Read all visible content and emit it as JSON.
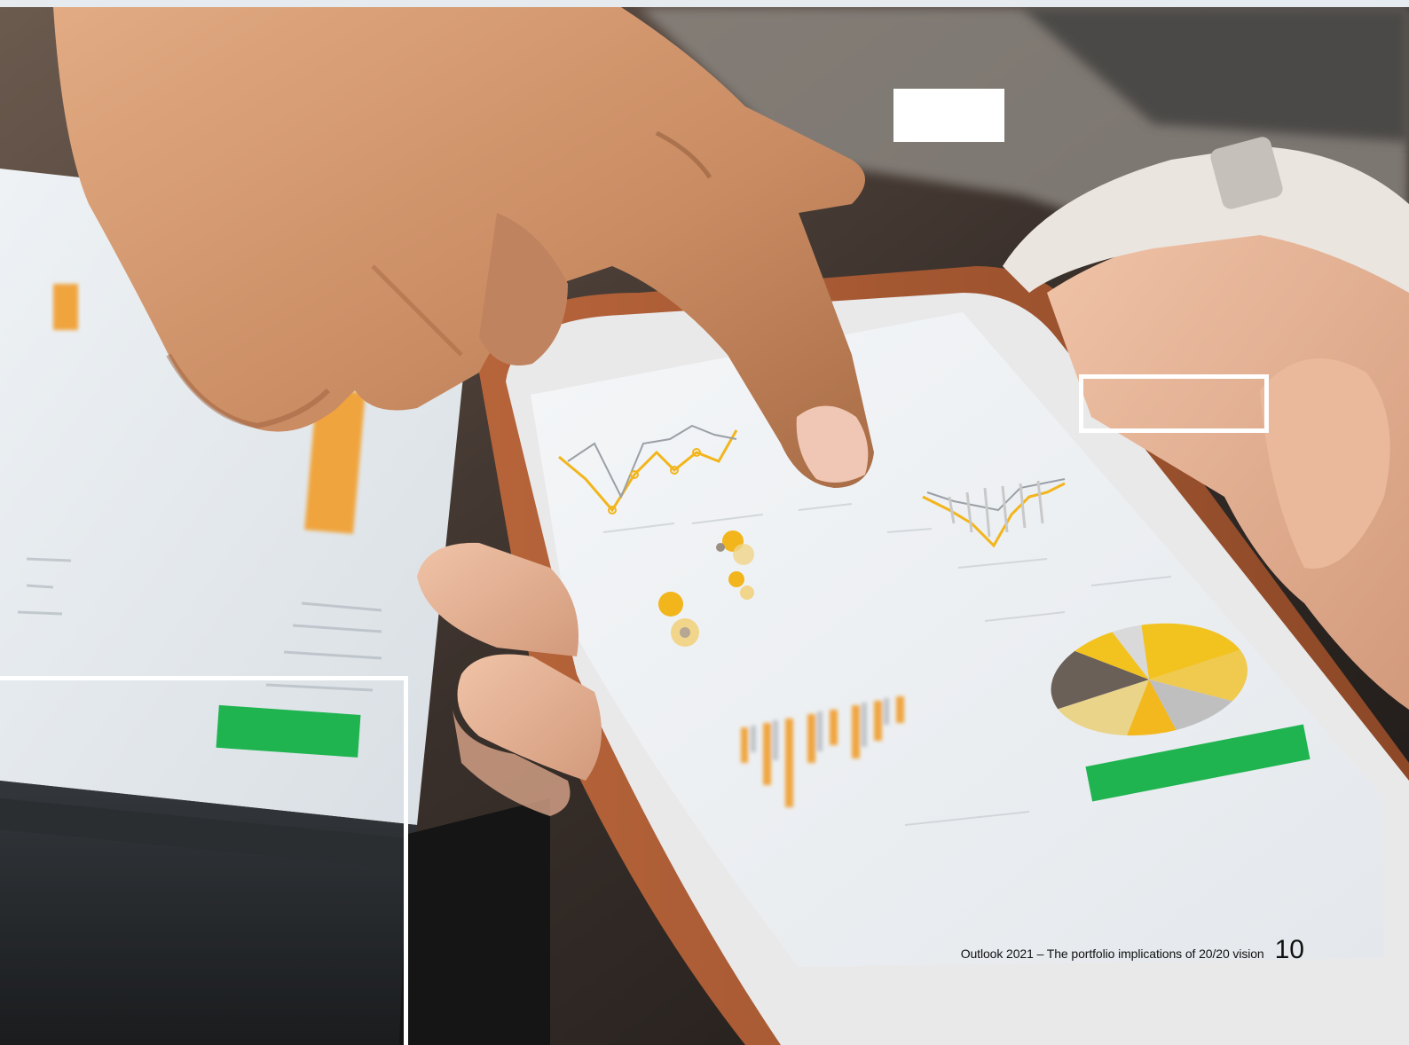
{
  "footer": {
    "title": "Outlook 2021 – The portfolio implications of 20/20 vision",
    "page_number": "10"
  },
  "colors": {
    "accent_yellow": "#f2b51c",
    "accent_orange": "#f0a43c",
    "accent_green": "#1fb450",
    "frame_white": "#ffffff"
  }
}
